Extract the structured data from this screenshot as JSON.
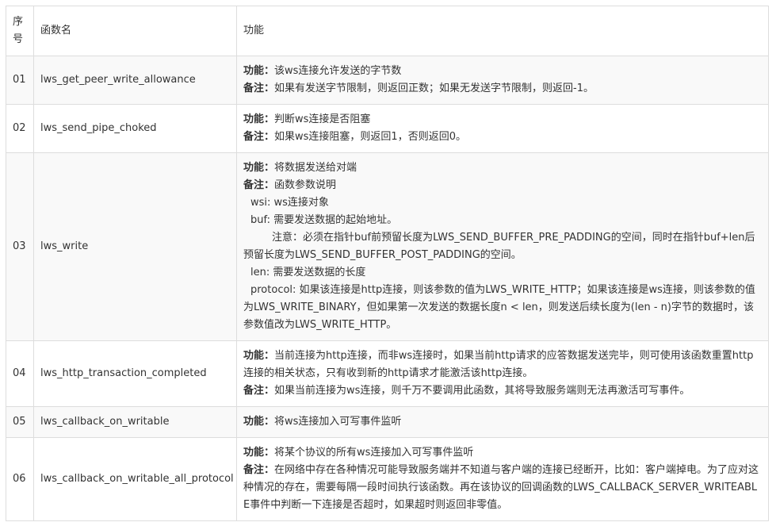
{
  "headers": {
    "num": "序号",
    "name": "函数名",
    "desc": "功能"
  },
  "rows": [
    {
      "num": "01",
      "name": "lws_get_peer_write_allowance",
      "lines": [
        {
          "label": "功能：",
          "text": "该ws连接允许发送的字节数"
        },
        {
          "label": "备注：",
          "text": "如果有发送字节限制，则返回正数；如果无发送字节限制，则返回-1。"
        }
      ]
    },
    {
      "num": "02",
      "name": "lws_send_pipe_choked",
      "lines": [
        {
          "label": "功能：",
          "text": "判断ws连接是否阻塞"
        },
        {
          "label": "备注：",
          "text": "如果ws连接阻塞，则返回1，否则返回0。"
        }
      ]
    },
    {
      "num": "03",
      "name": "lws_write",
      "lines": [
        {
          "label": "功能：",
          "text": "将数据发送给对端"
        },
        {
          "label": "备注：",
          "text": "函数参数说明"
        },
        {
          "label": "",
          "text": "wsi: ws连接对象"
        },
        {
          "label": "",
          "text": "buf: 需要发送数据的起始地址。"
        },
        {
          "label": "",
          "text": "注意：必须在指针buf前预留长度为LWS_SEND_BUFFER_PRE_PADDING的空间，同时在指针buf+len后预留长度为LWS_SEND_BUFFER_POST_PADDING的空间。"
        },
        {
          "label": "",
          "text": "len: 需要发送数据的长度"
        },
        {
          "label": "",
          "text": "protocol: 如果该连接是http连接，则该参数的值为LWS_WRITE_HTTP；如果该连接是ws连接，则该参数的值为LWS_WRITE_BINARY，但如果第一次发送的数据长度n < len，则发送后续长度为(len - n)字节的数据时，该参数值改为LWS_WRITE_HTTP。"
        }
      ]
    },
    {
      "num": "04",
      "name": "lws_http_transaction_completed",
      "lines": [
        {
          "label": "功能：",
          "text": "当前连接为http连接，而非ws连接时，如果当前http请求的应答数据发送完毕，则可使用该函数重置http连接的相关状态，只有收到新的http请求才能激活该http连接。"
        },
        {
          "label": "备注：",
          "text": "如果当前连接为ws连接，则千万不要调用此函数，其将导致服务端则无法再激活可写事件。"
        }
      ]
    },
    {
      "num": "05",
      "name": "lws_callback_on_writable",
      "lines": [
        {
          "label": "功能：",
          "text": "将ws连接加入可写事件监听"
        }
      ]
    },
    {
      "num": "06",
      "name": "lws_callback_on_writable_all_protocol",
      "lines": [
        {
          "label": "功能：",
          "text": "将某个协议的所有ws连接加入可写事件监听"
        },
        {
          "label": "备注：",
          "text": "在网络中存在各种情况可能导致服务端并不知道与客户端的连接已经断开，比如：客户端掉电。为了应对这种情况的存在，需要每隔一段时间执行该函数。再在该协议的回调函数的LWS_CALLBACK_SERVER_WRITEABLE事件中判断一下连接是否超时，如果超时则返回非零值。"
        }
      ]
    }
  ]
}
